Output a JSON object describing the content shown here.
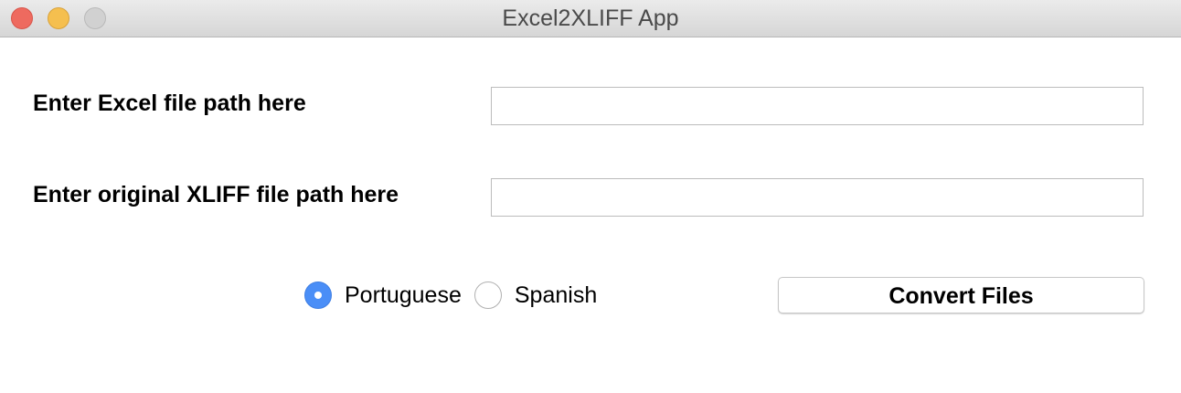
{
  "window": {
    "title": "Excel2XLIFF App"
  },
  "form": {
    "excel_path": {
      "label": "Enter Excel file path here",
      "value": "",
      "placeholder": ""
    },
    "xliff_path": {
      "label": "Enter original XLIFF file path here",
      "value": "",
      "placeholder": ""
    },
    "language": {
      "options": [
        {
          "label": "Portuguese",
          "selected": true
        },
        {
          "label": "Spanish",
          "selected": false
        }
      ]
    },
    "convert_button_label": "Convert Files"
  },
  "colors": {
    "close_light": "#ee6a5f",
    "minimize_light": "#f5bf4f",
    "zoom_light": "#d1d1d1",
    "radio_selected": "#4a8ef7"
  }
}
